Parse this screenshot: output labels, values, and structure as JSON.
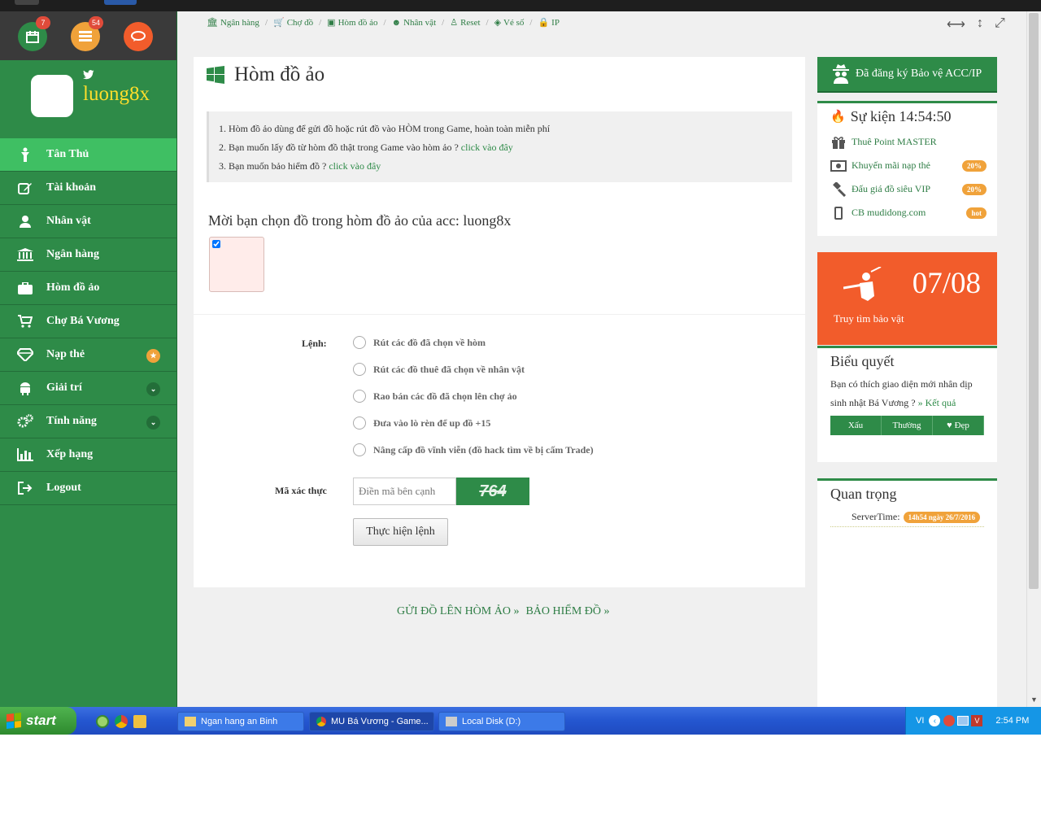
{
  "header": {
    "calendar_badge": "7",
    "list_badge": "54"
  },
  "sidebar": {
    "username": "luong8x",
    "items": [
      {
        "label": "Tân Thủ"
      },
      {
        "label": "Tài khoản"
      },
      {
        "label": "Nhân vật"
      },
      {
        "label": "Ngân hàng"
      },
      {
        "label": "Hòm đồ ảo"
      },
      {
        "label": "Chợ Bá Vương"
      },
      {
        "label": "Nạp thẻ"
      },
      {
        "label": "Giải trí"
      },
      {
        "label": "Tính năng"
      },
      {
        "label": "Xếp hạng"
      },
      {
        "label": "Logout"
      }
    ]
  },
  "breadcrumb": [
    "Ngân hàng",
    "Chợ đồ",
    "Hòm đồ ảo",
    "Nhân vật",
    "Reset",
    "Vé số",
    "IP"
  ],
  "main": {
    "title": "Hòm đồ ảo",
    "notes": [
      {
        "text": "1. Hòm đồ ảo dùng để gửi đồ hoặc rút đồ vào HÒM trong Game, hoàn toàn miễn phí",
        "link": ""
      },
      {
        "text": "2. Bạn muốn lấy đồ từ hòm đồ thật trong Game vào hòm ảo ? ",
        "link": "click vào đây"
      },
      {
        "text": "3. Bạn muốn bảo hiểm đồ ? ",
        "link": "click vào đây"
      }
    ],
    "choose_label": "Mời bạn chọn đồ trong hòm đồ ảo của acc: luong8x",
    "command_label": "Lệnh:",
    "commands": [
      "Rút các đồ đã chọn về hòm",
      "Rút các đồ thuê đã chọn về nhân vật",
      "Rao bán các đồ đã chọn lên chợ ảo",
      "Đưa vào lò rèn để up đồ +15",
      "Nâng cấp đồ vĩnh viễn (đồ hack tìm về bị cấm Trade)"
    ],
    "captcha_label": "Mã xác thực",
    "captcha_placeholder": "Điền mã bên cạnh",
    "captcha_code": "764",
    "submit_label": "Thực hiện lệnh"
  },
  "footer_links": [
    "GỬI ĐỒ LÊN HÒM ẢO",
    "BẢO HIỂM ĐỒ"
  ],
  "right": {
    "register_btn": "Đã đăng ký Bảo vệ ACC/IP",
    "events_title": "Sự kiện 14:54:50",
    "events": [
      {
        "label": "Thuê Point MASTER",
        "tag": ""
      },
      {
        "label": "Khuyến mãi nạp thẻ",
        "tag": "20%"
      },
      {
        "label": "Đấu giá đồ siêu VIP",
        "tag": "20%"
      },
      {
        "label": "CB mudidong.com",
        "tag": "hot"
      }
    ],
    "treasure_date": "07/08",
    "treasure_label": "Truy tìm bảo vật",
    "poll_title": "Biểu quyết",
    "poll_question": "Bạn có thích giao diện mới nhân dịp sinh nhật Bá Vương ? ",
    "poll_result": "» Kết quả",
    "poll_options": [
      "Xấu",
      "Thường",
      "Đẹp"
    ],
    "important_title": "Quan trọng",
    "server_time_label": "ServerTime:",
    "server_time_value": "14h54 ngày 26/7/2016"
  },
  "taskbar": {
    "start": "start",
    "tasks": [
      "Ngan hang an Binh",
      "MU Bá Vương - Game...",
      "Local Disk (D:)"
    ],
    "lang": "VI",
    "clock": "2:54 PM"
  },
  "colors": {
    "brand_green": "#2e8b48",
    "active_green": "#3fbf63",
    "orange": "#f25c2b",
    "badge_orange": "#f0a23a"
  }
}
